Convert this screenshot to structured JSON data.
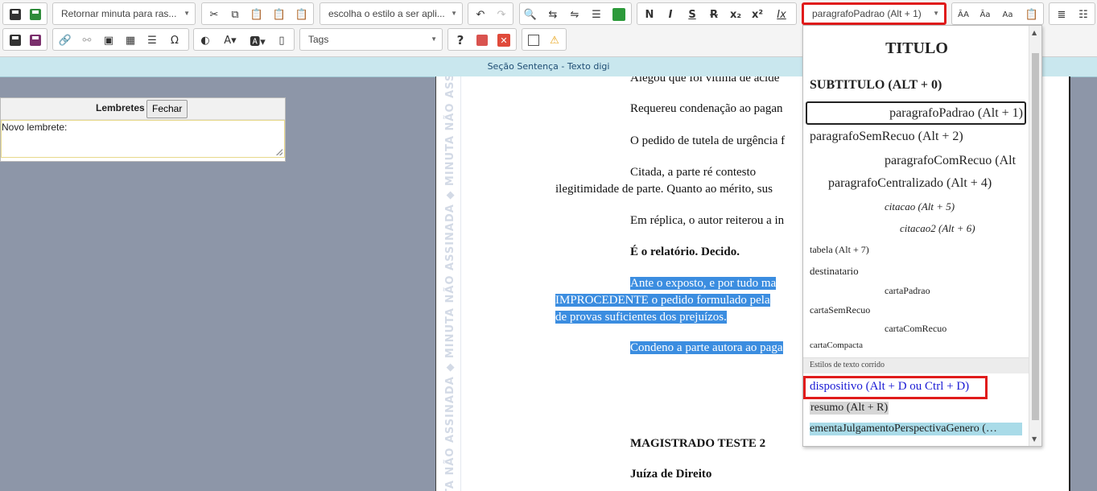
{
  "toolbar": {
    "row1": {
      "return_combo": "Retornar minuta para ras...",
      "style_combo": "escolha o estilo a ser apli...",
      "paragraph_combo": "paragrafoPadrao (Alt + 1)",
      "bold": "N",
      "italic": "I",
      "underline": "S",
      "strike": "R",
      "subscript": "x₂",
      "superscript": "x²",
      "clear_format": "Ix",
      "case_upper": "ĀA",
      "case_lower": "Āa",
      "case_mixed": "Aa"
    },
    "row2": {
      "tags_combo": "Tags",
      "help": "?",
      "warning": "⚠"
    }
  },
  "infobar": {
    "text": "Seção Sentença - Texto digi"
  },
  "reminders": {
    "title": "Lembretes",
    "close_label": "Fechar",
    "new_label": "Novo lembrete:"
  },
  "document": {
    "watermark": "TA NÃO ASSINADA ◆ MINUTA NÃO ASSINADA ◆ MINUTA NÃO ASSINADA ◆ MINUTA NÃO",
    "paragraphs": {
      "p0": "Alegou que foi vítima de acide",
      "p1": "Requereu condenação ao pagan",
      "p2": "O pedido de tutela de urgência f",
      "p3a": "Citada,   a   parte   ré   contesto",
      "p3b": "ilegitimidade de parte. Quanto ao mérito, sus",
      "p4": "Em réplica, o autor reiterou a in",
      "p5": "É o relatório. Decido.",
      "p6a": "Ante  o  exposto,  e  por  tudo  ma",
      "p6b": "IMPROCEDENTE o pedido formulado pela",
      "p6c": "de provas suficientes dos prejuízos.",
      "p7": "Condeno a parte autora ao paga",
      "sign_name": "MAGISTRADO TESTE 2",
      "sign_role": "Juíza de Direito"
    }
  },
  "dropdown": {
    "items": {
      "titulo": "TITULO",
      "subtitulo": "SUBTITULO (ALT + 0)",
      "padrao": "paragrafoPadrao (Alt + 1)",
      "semrecuo": "paragrafoSemRecuo (Alt + 2)",
      "comrecuo": "paragrafoComRecuo (Alt",
      "centralizado": "paragrafoCentralizado (Alt + 4)",
      "citacao": "citacao (Alt + 5)",
      "citacao2": "citacao2 (Alt + 6)",
      "tabela": "tabela (Alt + 7)",
      "destinatario": "destinatario",
      "cartapadrao": "cartaPadrao",
      "cartasemrecuo": "cartaSemRecuo",
      "cartacomrecuo": "cartaComRecuo",
      "cartacompacta": "cartaCompacta",
      "section_header": "Estilos de texto corrido",
      "dispositivo": "dispositivo (Alt + D ou Ctrl + D)",
      "resumo": "resumo (Alt + R)",
      "ementa": "ementaJulgamentoPerspectivaGenero (…"
    },
    "colors": {
      "dispositivo": "#1a1ad4",
      "highlight_resumo": "#d6d6d6",
      "highlight_ementa": "#a9dbe8"
    }
  }
}
